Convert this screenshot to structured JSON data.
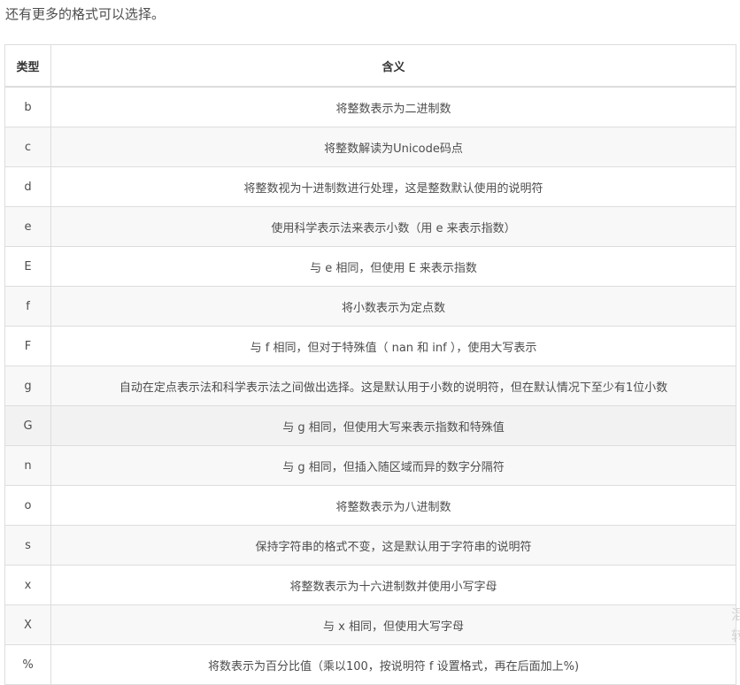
{
  "intro": "还有更多的格式可以选择。",
  "table": {
    "headers": [
      "类型",
      "含义"
    ],
    "rows": [
      {
        "type": "b",
        "meaning": "将整数表示为二进制数"
      },
      {
        "type": "c",
        "meaning": "将整数解读为Unicode码点"
      },
      {
        "type": "d",
        "meaning": "将整数视为十进制数进行处理，这是整数默认使用的说明符"
      },
      {
        "type": "e",
        "meaning": "使用科学表示法来表示小数（用 e 来表示指数）"
      },
      {
        "type": "E",
        "meaning": "与 e 相同，但使用 E 来表示指数"
      },
      {
        "type": "f",
        "meaning": "将小数表示为定点数"
      },
      {
        "type": "F",
        "meaning": "与 f 相同，但对于特殊值（ nan 和 inf ），使用大写表示"
      },
      {
        "type": "g",
        "meaning": "自动在定点表示法和科学表示法之间做出选择。这是默认用于小数的说明符，但在默认情况下至少有1位小数"
      },
      {
        "type": "G",
        "meaning": "与 g 相同，但使用大写来表示指数和特殊值"
      },
      {
        "type": "n",
        "meaning": "与 g 相同，但插入随区域而异的数字分隔符"
      },
      {
        "type": "o",
        "meaning": "将整数表示为八进制数"
      },
      {
        "type": "s",
        "meaning": "保持字符串的格式不变，这是默认用于字符串的说明符"
      },
      {
        "type": "x",
        "meaning": "将整数表示为十六进制数并使用小写字母"
      },
      {
        "type": "X",
        "meaning": "与 x 相同，但使用大写字母"
      },
      {
        "type": "%",
        "meaning": "将数表示为百分比值（乘以100，按说明符 f 设置格式，再在后面加上%)"
      }
    ]
  },
  "side_text": [
    "混",
    "转"
  ]
}
